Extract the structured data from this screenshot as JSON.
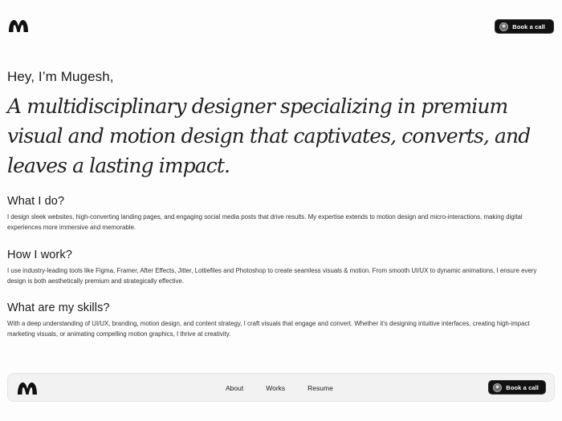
{
  "header": {
    "logo_name": "M",
    "cta_label": "Book a call"
  },
  "hero": {
    "greeting": "Hey, I’m Mugesh,",
    "headline": "A multidisciplinary designer specializing in premium visual and motion design that captivates, converts, and leaves a lasting impact."
  },
  "sections": [
    {
      "title": "What I do?",
      "body": "I design sleek websites, high-converting landing pages, and engaging social media posts that drive results. My expertise extends to motion design and micro-interactions, making digital experiences more immersive and memorable."
    },
    {
      "title": "How I work?",
      "body": "I use industry-leading tools like Figma, Framer, After Effects, Jitter, Lottiefiles and Photoshop to create seamless visuals & motion. From smooth UI/UX to dynamic animations, I ensure every design is both aesthetically premium and strategically effective."
    },
    {
      "title": "What are my skills?",
      "body": "With a deep understanding of UI/UX, branding, motion design, and content strategy, I craft visuals that engage and convert. Whether it’s designing intuitive interfaces, creating high-impact marketing visuals, or animating compelling motion graphics, I thrive at creativity."
    }
  ],
  "footer_nav": {
    "items": [
      "About",
      "Works",
      "Resume"
    ],
    "cta_label": "Book a call"
  },
  "colors": {
    "background": "#fdfdfd",
    "button": "#111111",
    "text": "#1a1a1a"
  }
}
